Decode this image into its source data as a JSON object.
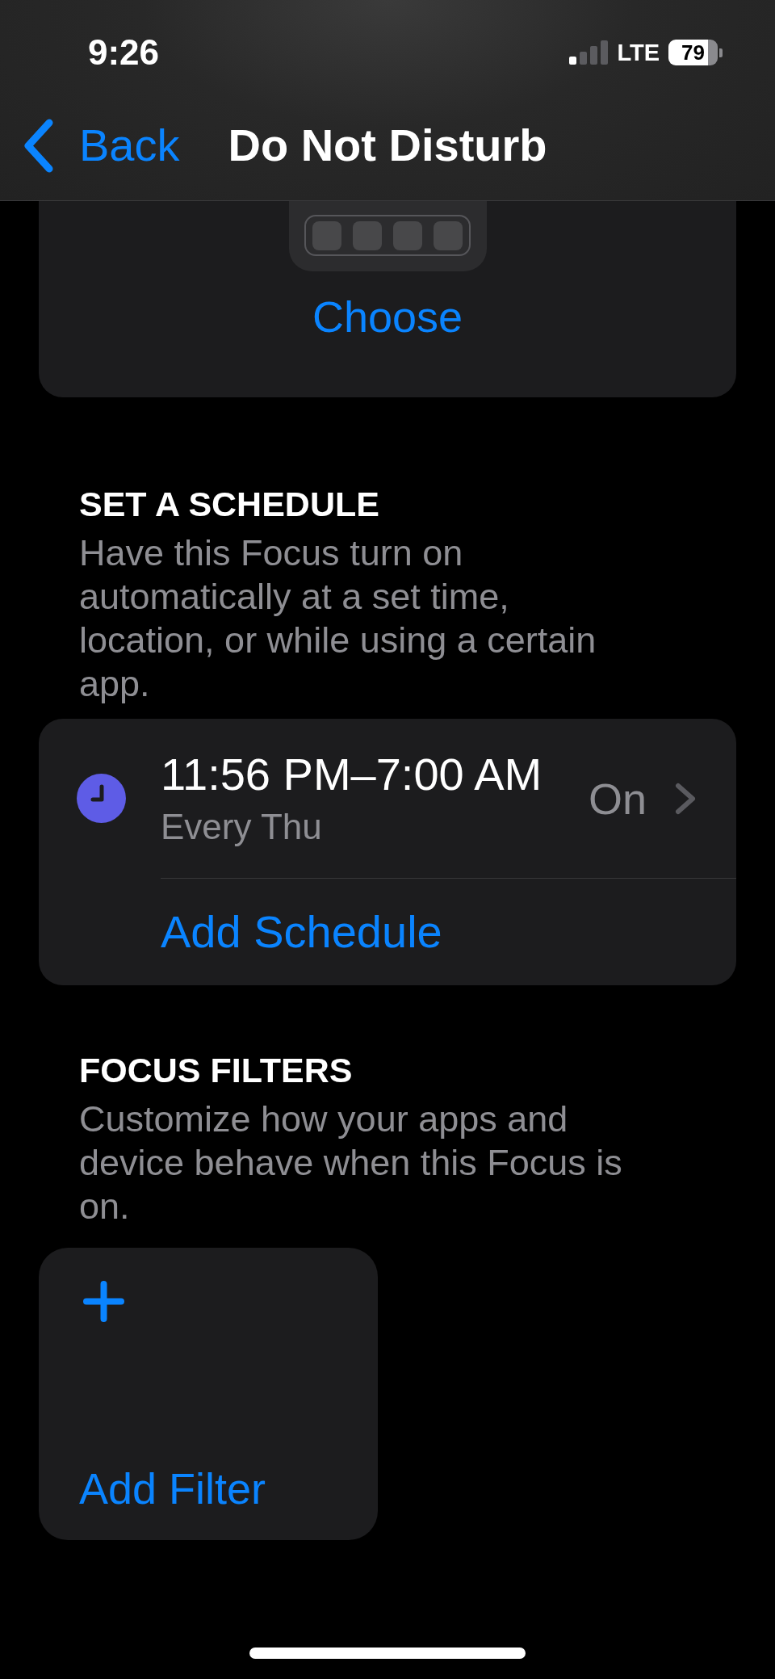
{
  "status_bar": {
    "time": "9:26",
    "network": "LTE",
    "battery": "79"
  },
  "nav_bar": {
    "back_label": "Back",
    "title": "Do Not Disturb"
  },
  "home_screen": {
    "action": "Choose"
  },
  "sections": [
    {
      "kind": "schedule",
      "heading": "SET A SCHEDULE",
      "description": "Have this Focus turn on automatically at a set time, location, or while using a certain app.",
      "items": [
        {
          "time_range": "11:56 PM–7:00 AM",
          "repeat": "Every Thu",
          "status": "On"
        }
      ],
      "add_label": "Add Schedule"
    },
    {
      "kind": "filters",
      "heading": "FOCUS FILTERS",
      "description": "Customize how your apps and device behave when this Focus is on.",
      "add_label": "Add Filter"
    }
  ]
}
